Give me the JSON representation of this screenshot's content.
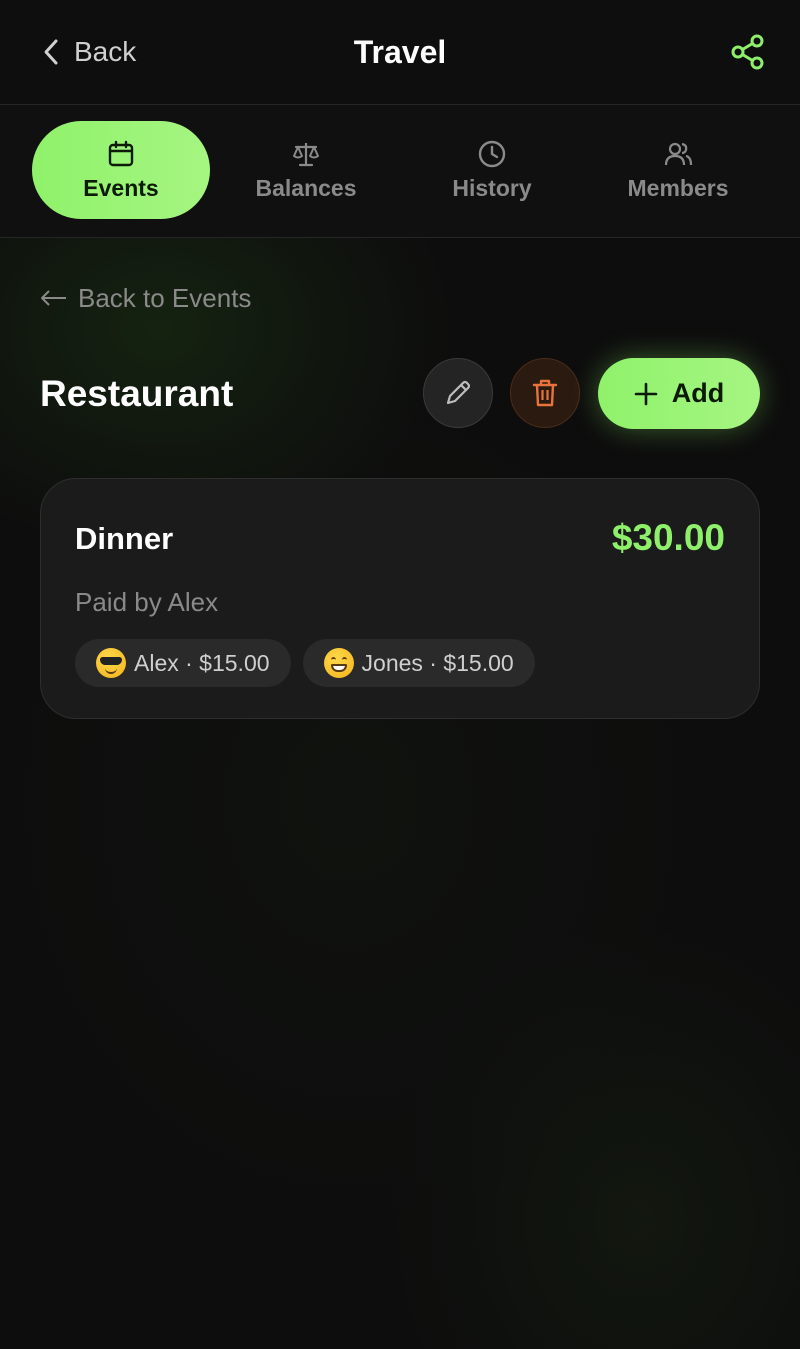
{
  "header": {
    "back_label": "Back",
    "title": "Travel"
  },
  "tabs": [
    {
      "label": "Events",
      "icon": "calendar-icon",
      "active": true
    },
    {
      "label": "Balances",
      "icon": "scale-icon",
      "active": false
    },
    {
      "label": "History",
      "icon": "clock-icon",
      "active": false
    },
    {
      "label": "Members",
      "icon": "users-icon",
      "active": false
    }
  ],
  "nav": {
    "back_to_events": "Back to Events"
  },
  "event": {
    "title": "Restaurant",
    "add_label": "Add"
  },
  "expense": {
    "name": "Dinner",
    "amount": "$30.00",
    "paid_by": "Paid by Alex",
    "splits": [
      {
        "label": "Alex · $15.00",
        "emoji": "smiling-face-with-sunglasses"
      },
      {
        "label": "Jones · $15.00",
        "emoji": "grinning-face"
      }
    ]
  },
  "colors": {
    "accent": "#8ef06a",
    "background": "#0d0d0d",
    "card": "#1b1b1b",
    "delete": "#e8743c"
  }
}
